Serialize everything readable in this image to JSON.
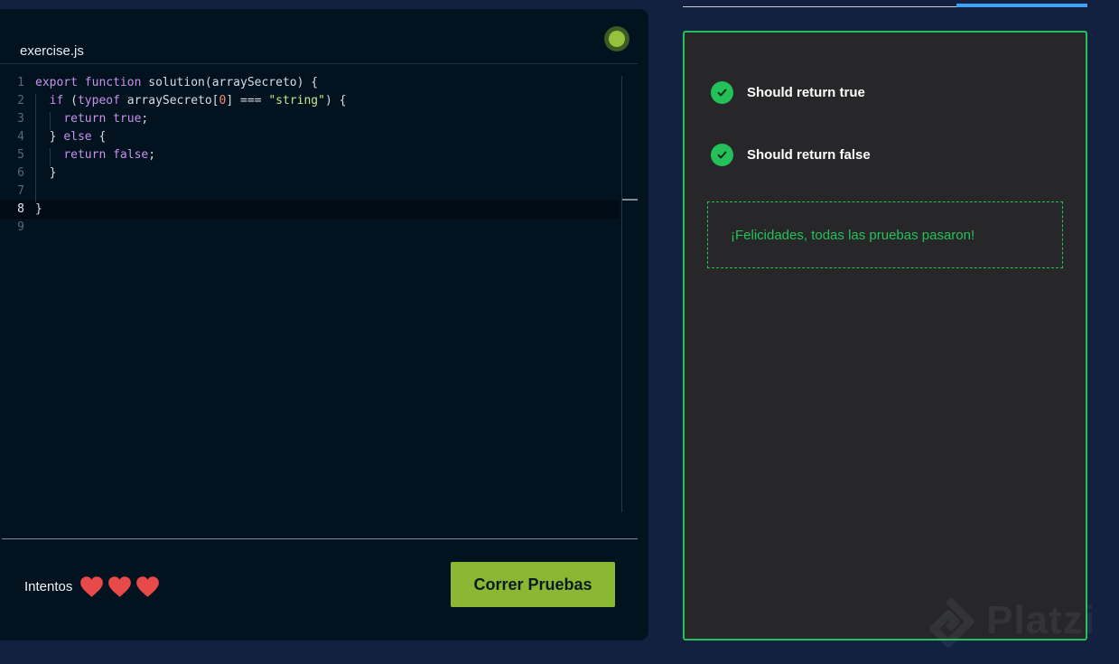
{
  "editor": {
    "filename": "exercise.js",
    "lines": [
      {
        "n": "1",
        "html": "<span class=\"kw\">export</span> <span class=\"kw\">function</span> solution(arraySecreto) {"
      },
      {
        "n": "2",
        "html": "  <span class=\"kw\">if</span> (<span class=\"kw\">typeof</span> arraySecreto[<span class=\"num\">0</span>] === <span class=\"str\">\"string\"</span>) {"
      },
      {
        "n": "3",
        "html": "    <span class=\"kw\">return</span> <span class=\"kw\">true</span>;"
      },
      {
        "n": "4",
        "html": "  } <span class=\"kw\">else</span> {"
      },
      {
        "n": "5",
        "html": "    <span class=\"kw\">return</span> <span class=\"kw\">false</span>;"
      },
      {
        "n": "6",
        "html": "  }"
      },
      {
        "n": "7",
        "html": ""
      },
      {
        "n": "8",
        "html": "}"
      },
      {
        "n": "9",
        "html": ""
      }
    ],
    "active_line": 8
  },
  "footer": {
    "attempts_label": "Intentos",
    "hearts": 3,
    "run_button": "Correr Pruebas"
  },
  "results": {
    "tests": [
      {
        "label": "Should return true",
        "status": "passed"
      },
      {
        "label": "Should return false",
        "status": "passed"
      }
    ],
    "success_message": "¡Felicidades, todas las pruebas pasaron!"
  },
  "watermark": {
    "text": "Platzi"
  },
  "colors": {
    "accent_green": "#24c15a",
    "button_green": "#8ab832",
    "progress_blue": "#3fa3f5",
    "heart_red": "#e84a4a"
  }
}
